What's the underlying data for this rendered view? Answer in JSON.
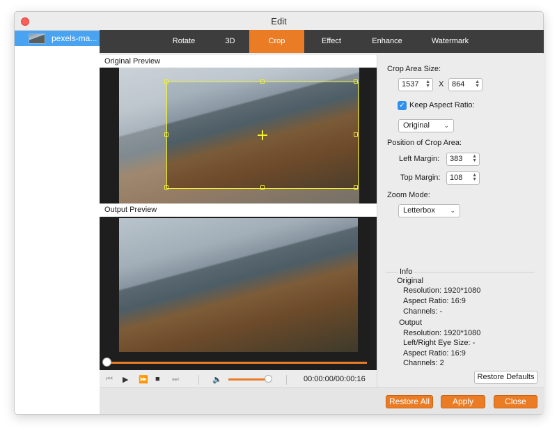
{
  "window": {
    "title": "Edit"
  },
  "sidebar": {
    "items": [
      {
        "label": "pexels-ma..."
      }
    ]
  },
  "tabs": [
    {
      "label": "Rotate",
      "active": false
    },
    {
      "label": "3D",
      "active": false
    },
    {
      "label": "Crop",
      "active": true
    },
    {
      "label": "Effect",
      "active": false
    },
    {
      "label": "Enhance",
      "active": false
    },
    {
      "label": "Watermark",
      "active": false
    }
  ],
  "preview": {
    "original_label": "Original Preview",
    "output_label": "Output Preview",
    "timecode": "00:00:00/00:00:16",
    "volume_percent": 100
  },
  "crop": {
    "area_size_label": "Crop Area Size:",
    "width": "1537",
    "x_label": "X",
    "height": "864",
    "keep_aspect_label": "Keep Aspect Ratio:",
    "keep_aspect_checked": true,
    "aspect_option": "Original",
    "position_label": "Position of Crop Area:",
    "left_margin_label": "Left Margin:",
    "left_margin": "383",
    "top_margin_label": "Top Margin:",
    "top_margin": "108",
    "zoom_mode_label": "Zoom Mode:",
    "zoom_mode": "Letterbox"
  },
  "info": {
    "title": "Info",
    "original_heading": "Original",
    "original_resolution": "Resolution: 1920*1080",
    "original_aspect": "Aspect Ratio: 16:9",
    "original_channels": "Channels: -",
    "output_heading": "Output",
    "output_resolution": "Resolution: 1920*1080",
    "output_eye_size": "Left/Right Eye Size: -",
    "output_aspect": "Aspect Ratio: 16:9",
    "output_channels": "Channels: 2"
  },
  "buttons": {
    "restore_defaults": "Restore Defaults",
    "restore_all": "Restore All",
    "apply": "Apply",
    "close": "Close"
  },
  "colors": {
    "accent": "#ea7c26",
    "selection": "#4aa3f0",
    "crop_frame": "#f1f12e",
    "tabbar": "#3d3d3d"
  },
  "icons": [
    "close-window-icon",
    "skip-back-icon",
    "play-icon",
    "fast-forward-icon",
    "stop-icon",
    "skip-forward-icon",
    "volume-icon",
    "checkmark-icon",
    "chevron-down-icon",
    "spinner-arrows-icon",
    "crop-center-crosshair-icon"
  ]
}
